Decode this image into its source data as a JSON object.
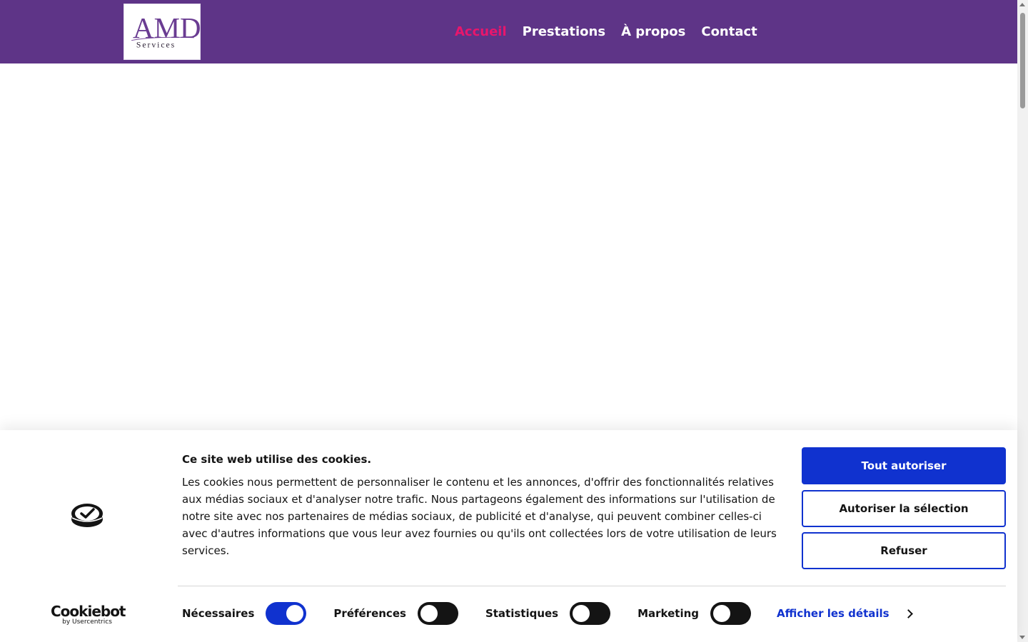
{
  "header": {
    "logo": {
      "main": "AMD",
      "sub": "Services"
    },
    "nav": [
      {
        "label": "Accueil",
        "active": true
      },
      {
        "label": "Prestations",
        "active": false
      },
      {
        "label": "À propos",
        "active": false
      },
      {
        "label": "Contact",
        "active": false
      }
    ]
  },
  "cookie_banner": {
    "brand": {
      "name": "Cookiebot",
      "sub": "by Usercentrics"
    },
    "title": "Ce site web utilise des cookies.",
    "text": "Les cookies nous permettent de personnaliser le contenu et les annonces, d'offrir des fonctionnalités relatives aux médias sociaux et d'analyser notre trafic. Nous partageons également des informations sur l'utilisation de notre site avec nos partenaires de médias sociaux, de publicité et d'analyse, qui peuvent combiner celles-ci avec d'autres informations que vous leur avez fournies ou qu'ils ont collectées lors de votre utilisation de leurs services.",
    "buttons": {
      "allow_all": "Tout autoriser",
      "allow_selection": "Autoriser la sélection",
      "refuse": "Refuser"
    },
    "toggles": [
      {
        "label": "Nécessaires",
        "on": true
      },
      {
        "label": "Préférences",
        "on": false
      },
      {
        "label": "Statistiques",
        "on": false
      },
      {
        "label": "Marketing",
        "on": false
      }
    ],
    "details_link": "Afficher les détails"
  },
  "colors": {
    "header_bg": "#5e3487",
    "nav_active": "#e8166c",
    "accent_blue": "#1032cf",
    "text_dark": "#141414"
  },
  "icons": [
    "cookiebot-logo-icon",
    "chevron-right-icon"
  ]
}
